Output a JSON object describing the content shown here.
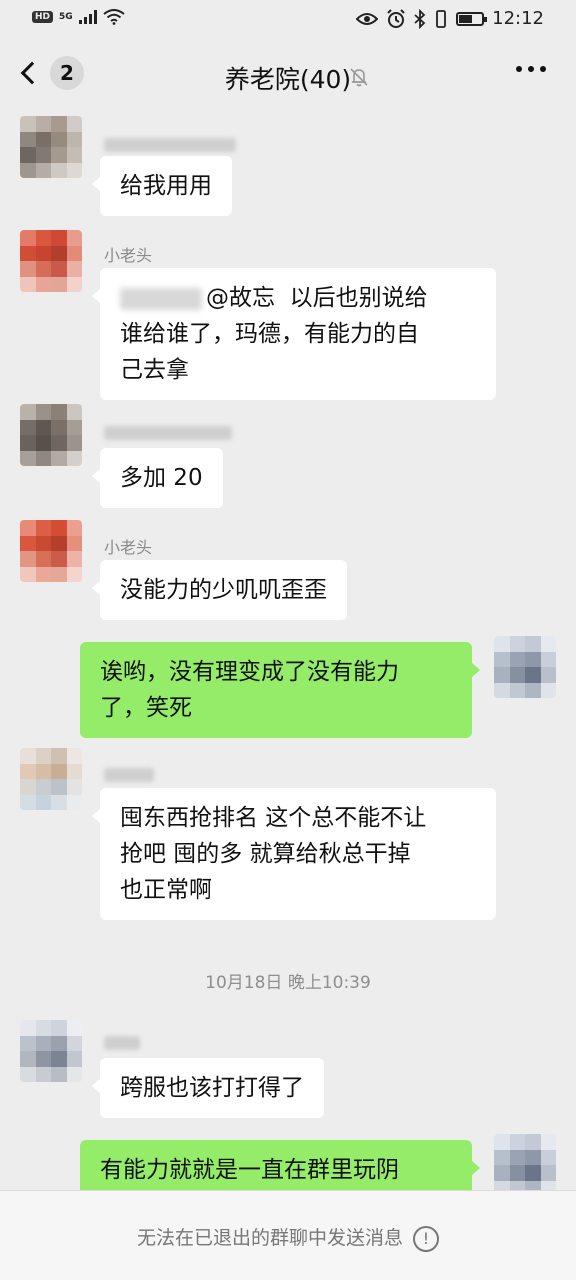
{
  "status_bar": {
    "hd": "HD",
    "network": "5G",
    "time": "12:12",
    "battery_level": 0.6,
    "icons": [
      "signal-icon",
      "wifi-icon",
      "eye-icon",
      "alarm-icon",
      "bluetooth-icon",
      "vibrate-icon",
      "battery-icon"
    ]
  },
  "nav": {
    "unread_count": "2",
    "title": "养老院(40)",
    "icons": {
      "back": "chevron-left-icon",
      "mute": "bell-off-icon",
      "more": "more-icon"
    }
  },
  "messages": [
    {
      "sender": "",
      "text": "给我用用",
      "side": "left"
    },
    {
      "sender": "小老头",
      "mention": "@故忘",
      "text_line1": "以后也别说给",
      "text_line2": "谁给谁了，玛德，有能力的自",
      "text_line3": "己去拿",
      "side": "left"
    },
    {
      "sender": "",
      "text": "多加 20",
      "side": "left"
    },
    {
      "sender": "小老头",
      "text": "没能力的少叽叽歪歪",
      "side": "left"
    },
    {
      "sender": "",
      "text_line1": "诶哟，没有理变成了没有能力",
      "text_line2": "了，笑死",
      "side": "right"
    },
    {
      "sender": "",
      "text_line1": "囤东西抢排名 这个总不能不让",
      "text_line2": "抢吧 囤的多 就算给秋总干掉",
      "text_line3": "也正常啊",
      "side": "left"
    },
    {
      "sender": "",
      "text": "跨服也该打打得了",
      "side": "left"
    },
    {
      "sender": "",
      "text": "有能力就就是一直在群里玩阴",
      "side": "right"
    }
  ],
  "timestamp": "10月18日 晚上10:39",
  "bottom": {
    "notice": "无法在已退出的群聊中发送消息",
    "info_glyph": "!"
  },
  "colors": {
    "background": "#ededed",
    "my_bubble": "#95ec69",
    "their_bubble": "#ffffff"
  }
}
